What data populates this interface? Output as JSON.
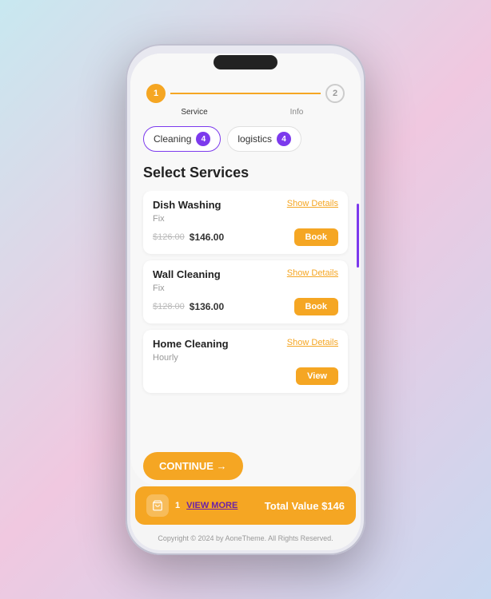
{
  "phone": {
    "steps": [
      {
        "number": "1",
        "label": "Service",
        "active": true
      },
      {
        "number": "2",
        "label": "Info",
        "active": false
      }
    ],
    "tabs": [
      {
        "id": "cleaning",
        "label": "Cleaning",
        "badge": "4",
        "active": true
      },
      {
        "id": "logistics",
        "label": "logistics",
        "badge": "4",
        "active": false
      }
    ],
    "section_title": "Select Services",
    "services": [
      {
        "name": "Dish Washing",
        "type": "Fix",
        "show_details": "Show Details",
        "price_old": "$126.00",
        "price_new": "$146.00",
        "action_label": "Book",
        "action_type": "book"
      },
      {
        "name": "Wall Cleaning",
        "type": "Fix",
        "show_details": "Show Details",
        "price_old": "$128.00",
        "price_new": "$136.00",
        "action_label": "Book",
        "action_type": "book"
      },
      {
        "name": "Home Cleaning",
        "type": "Hourly",
        "show_details": "Show Details",
        "price_old": "",
        "price_new": "",
        "action_label": "View",
        "action_type": "view"
      }
    ],
    "continue_button": "CONTINUE →",
    "cart": {
      "count": "1",
      "view_more": "VIEW MORE",
      "total_label": "Total Value $146"
    },
    "footer": "Copyright © 2024 by AoneTheme. All Rights Reserved."
  }
}
